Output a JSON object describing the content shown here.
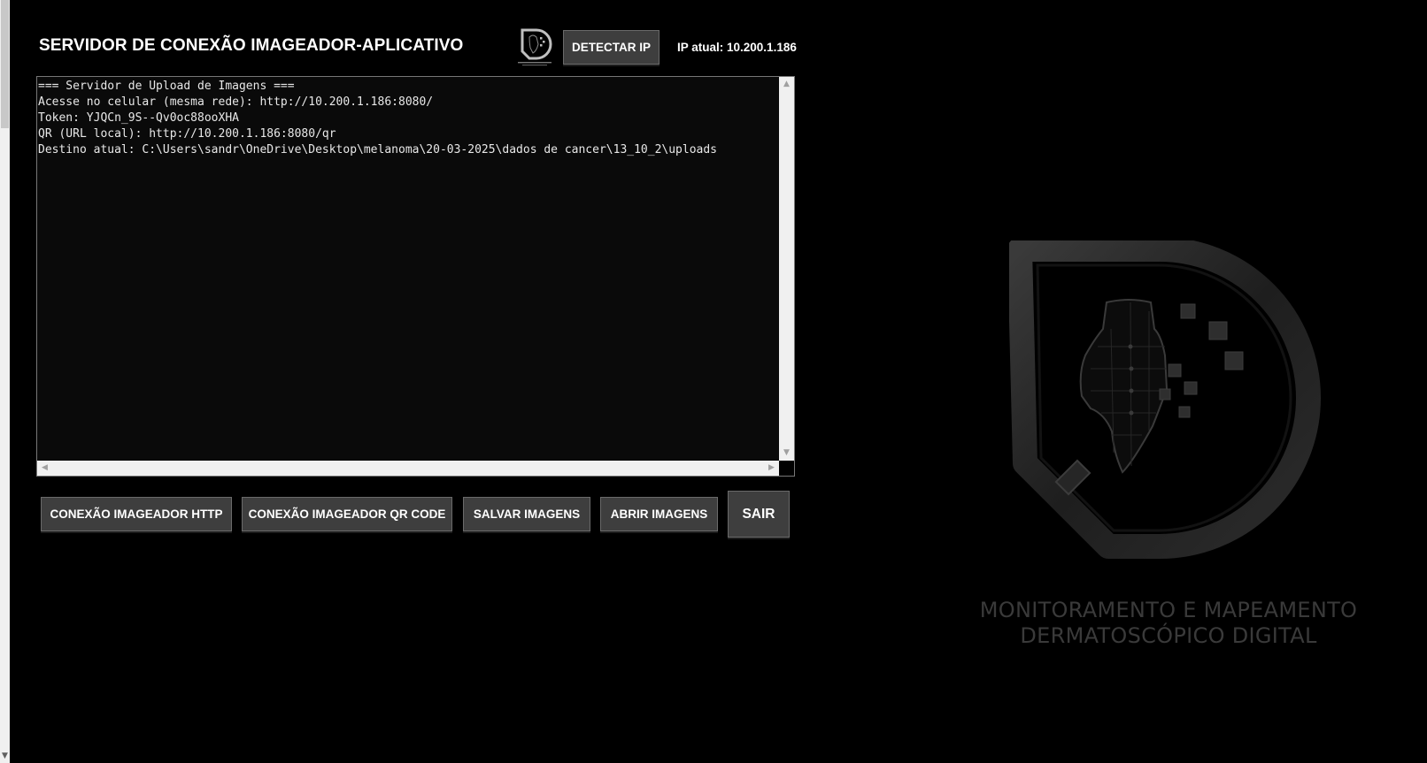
{
  "header": {
    "title": "SERVIDOR DE CONEXÃO IMAGEADOR-APLICATIVO",
    "detect_ip_label": "DETECTAR IP",
    "ip_status": "IP atual: 10.200.1.186"
  },
  "console": {
    "lines": [
      "=== Servidor de Upload de Imagens ===",
      "Acesse no celular (mesma rede): http://10.200.1.186:8080/",
      "Token: YJQCn_9S--Qv0oc88ooXHA",
      "QR (URL local): http://10.200.1.186:8080/qr",
      "Destino atual: C:\\Users\\sandr\\OneDrive\\Desktop\\melanoma\\20-03-2025\\dados de cancer\\13_10_2\\uploads"
    ]
  },
  "actions": {
    "http_label": "CONEXÃO IMAGEADOR HTTP",
    "qr_label": "CONEXÃO IMAGEADOR QR CODE",
    "save_label": "SALVAR IMAGENS",
    "open_label": "ABRIR IMAGENS",
    "exit_label": "SAIR"
  },
  "brand": {
    "line1": "MONITORAMENTO E MAPEAMENTO",
    "line2": "DERMATOSCÓPICO DIGITAL",
    "small_logo_caption": "MONITORAMENTO E MAPEAMENTO DERMATOSCÓPICO DIGITAL",
    "logo_icon": "dermatoscopy-shield-logo"
  },
  "colors": {
    "background": "#000000",
    "button": "#3e3e3e",
    "console_bg": "#0a0a0a",
    "brand_text": "#3a3a3a"
  }
}
